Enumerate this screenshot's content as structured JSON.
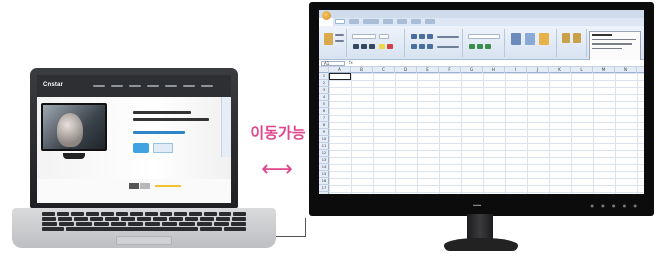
{
  "center_label": {
    "text": "이동가능",
    "arrow": "⟷",
    "color": "#e0468c"
  },
  "laptop": {
    "site_logo": "Cnstar",
    "site_tagline": "",
    "icon": "laptop-icon"
  },
  "monitor": {
    "app": "spreadsheet",
    "name_box": "A1",
    "formula_icon": "fx",
    "selected_cell": "A1",
    "columns": [
      "A",
      "B",
      "C",
      "D",
      "E",
      "F",
      "G",
      "H",
      "I",
      "J",
      "K",
      "L",
      "M",
      "N"
    ],
    "rows": [
      "1",
      "2",
      "3",
      "4",
      "5",
      "6",
      "7",
      "8",
      "9",
      "10",
      "11",
      "12",
      "13",
      "14",
      "15",
      "16",
      "17"
    ],
    "icon": "monitor-icon"
  },
  "colors": {
    "laptop_body": "#2a2b2e",
    "monitor_bezel": "#0c0c0d",
    "ribbon": "#d7e3f1",
    "accent_pink": "#e0468c"
  }
}
